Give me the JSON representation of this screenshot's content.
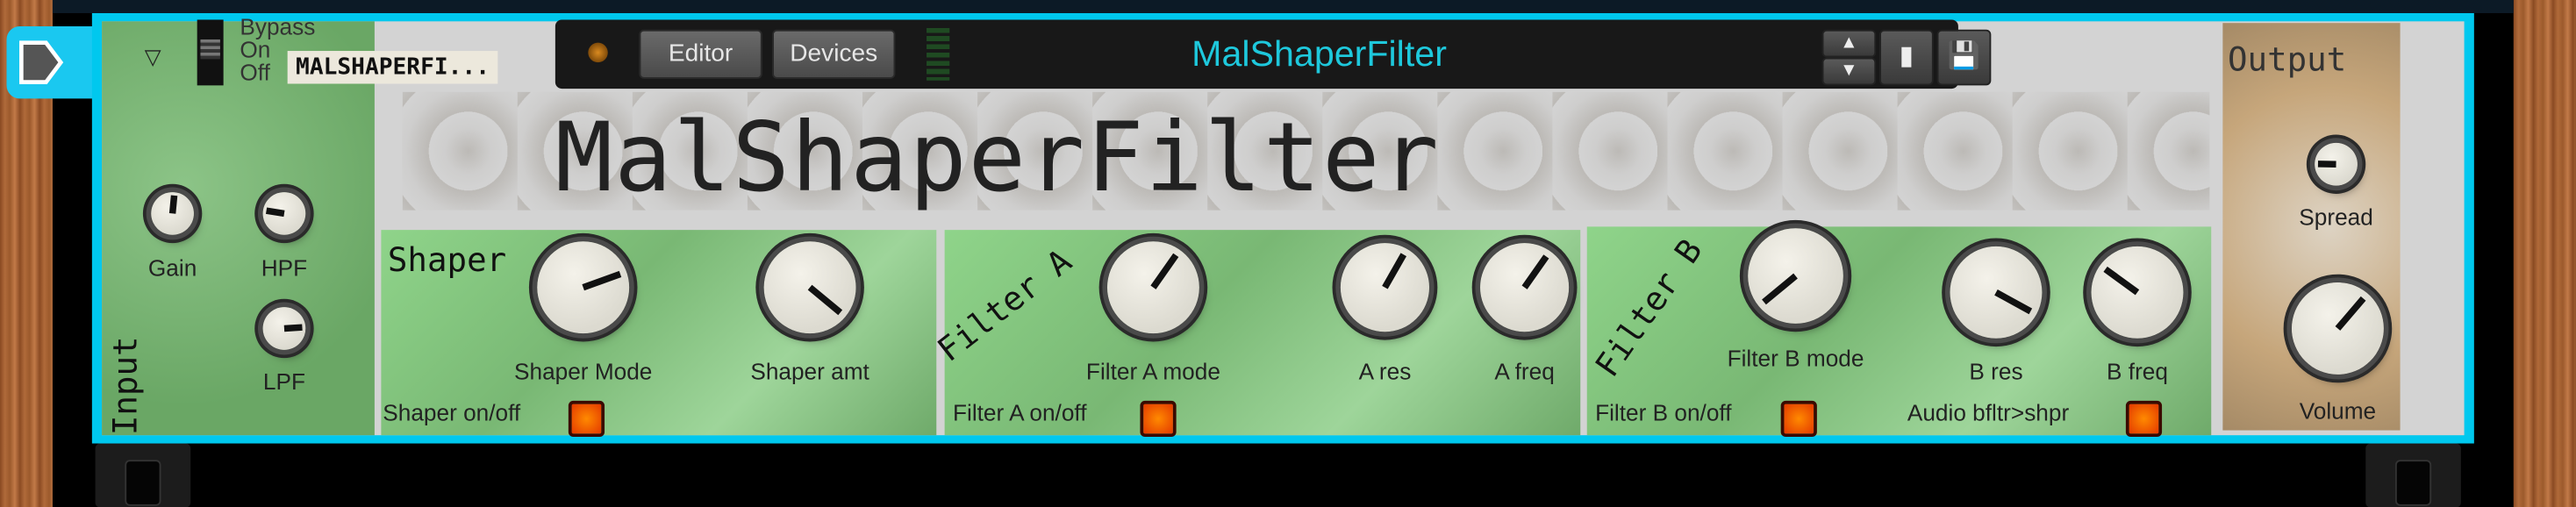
{
  "device": {
    "name_tape": "MALSHAPERFI...",
    "title": "MalShaperFilter",
    "logo_title": "MalShaperFilter",
    "accent": "#00c8ee"
  },
  "header": {
    "collapse_icon": "triangle-down-icon",
    "bypass": {
      "options": [
        "Bypass",
        "On",
        "Off"
      ],
      "selected": "On"
    }
  },
  "toolbar": {
    "editor": "Editor",
    "devices": "Devices",
    "preset_up_icon": "arrow-up-icon",
    "preset_down_icon": "arrow-down-icon",
    "browse_icon": "folder-icon",
    "save_icon": "floppy-disk-icon"
  },
  "sections": {
    "input": "Input",
    "shaper": "Shaper",
    "filter_a": "Filter A",
    "filter_b": "Filter B",
    "output": "Output"
  },
  "knobs": [
    {
      "label": "Gain",
      "value": 0.52
    },
    {
      "label": "HPF",
      "value": 0.2
    },
    {
      "label": "LPF",
      "value": 0.82
    },
    {
      "label": "Shaper Mode",
      "value": 0.76
    },
    {
      "label": "Shaper amt",
      "value": 0.98
    },
    {
      "label": "Filter A mode",
      "value": 0.63
    },
    {
      "label": "A res",
      "value": 0.61
    },
    {
      "label": "A freq",
      "value": 0.63
    },
    {
      "label": "Filter B mode",
      "value": 0.02
    },
    {
      "label": "B res",
      "value": 0.94
    },
    {
      "label": "B freq",
      "value": 0.3
    },
    {
      "label": "Spread",
      "value": 0.17
    },
    {
      "label": "Volume",
      "value": 0.65
    }
  ],
  "switches": [
    {
      "label": "Shaper on/off",
      "on": true
    },
    {
      "label": "Filter A on/off",
      "on": true
    },
    {
      "label": "Filter B on/off",
      "on": true
    },
    {
      "label": "Audio bfltr>shpr",
      "on": true
    }
  ]
}
